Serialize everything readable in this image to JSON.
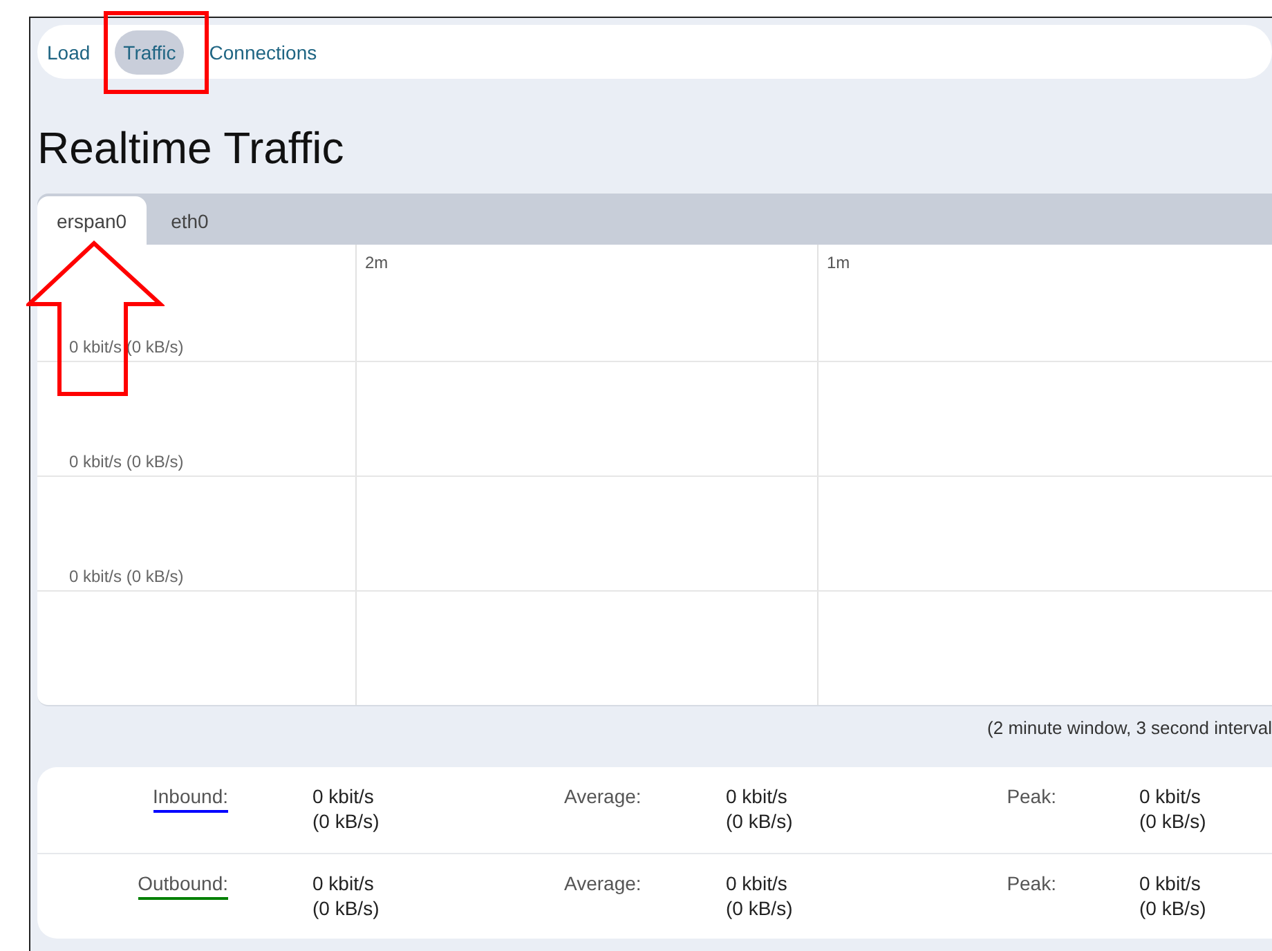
{
  "nav_tabs": [
    {
      "label": "Load",
      "selected": false
    },
    {
      "label": "Traffic",
      "selected": true
    },
    {
      "label": "Connections",
      "selected": false
    }
  ],
  "title": "Realtime Traffic",
  "interface_tabs": [
    {
      "label": "erspan0",
      "selected": true
    },
    {
      "label": "eth0",
      "selected": false
    }
  ],
  "graph": {
    "time_labels": [
      "2m",
      "1m"
    ],
    "scale_labels": [
      "0 kbit/s (0 kB/s)",
      "0 kbit/s (0 kB/s)",
      "0 kbit/s (0 kB/s)"
    ]
  },
  "graph_caption": "(2 minute window, 3 second interval",
  "stats": [
    {
      "label": "Inbound:",
      "color": "#0000ff",
      "current": "0 kbit/s",
      "current_bytes": "(0 kB/s)",
      "average_label": "Average:",
      "average": "0 kbit/s",
      "average_bytes": "(0 kB/s)",
      "peak_label": "Peak:",
      "peak": "0 kbit/s",
      "peak_bytes": "(0 kB/s)"
    },
    {
      "label": "Outbound:",
      "color": "#008000",
      "current": "0 kbit/s",
      "current_bytes": "(0 kB/s)",
      "average_label": "Average:",
      "average": "0 kbit/s",
      "average_bytes": "(0 kB/s)",
      "peak_label": "Peak:",
      "peak": "0 kbit/s",
      "peak_bytes": "(0 kB/s)"
    }
  ]
}
